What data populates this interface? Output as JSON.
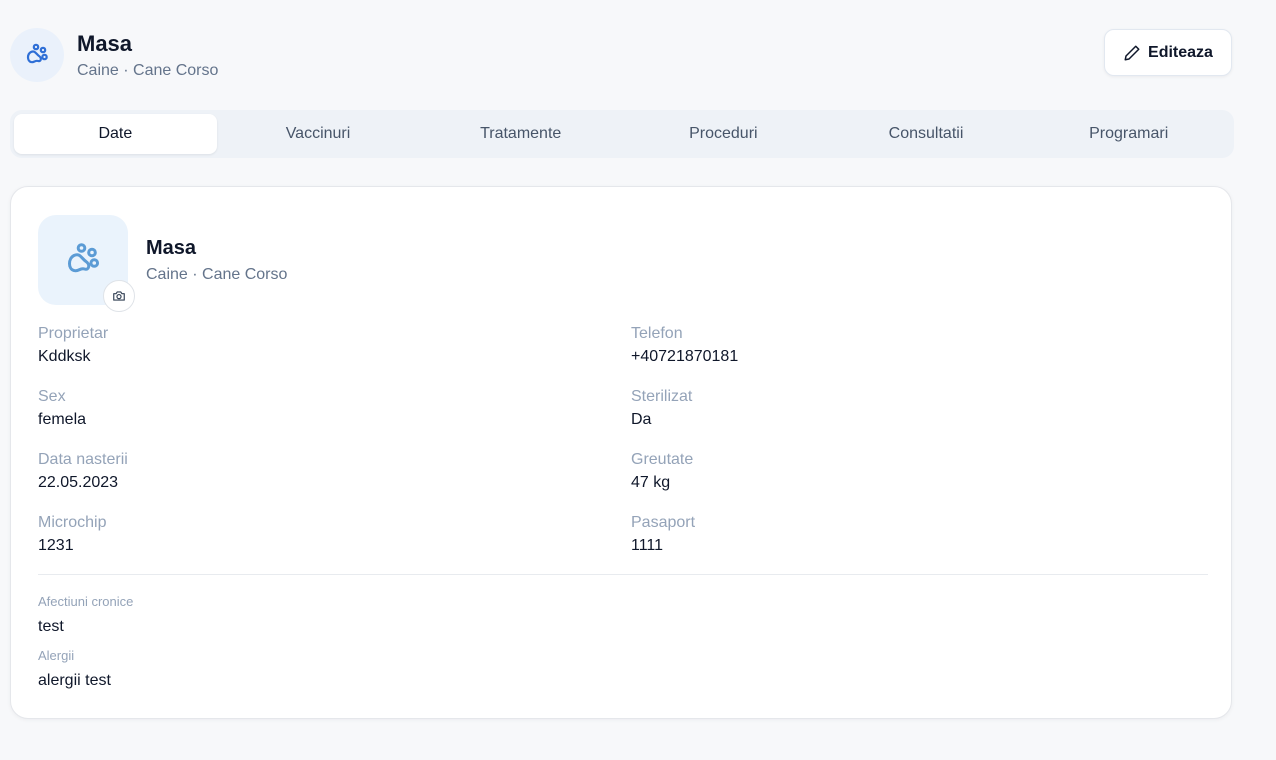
{
  "header": {
    "name": "Masa",
    "subtitle": "Caine · Cane Corso",
    "avatar_icon": "paw-icon",
    "edit_label": "Editeaza",
    "edit_icon": "pencil-icon"
  },
  "tabs": [
    {
      "label": "Date",
      "active": true
    },
    {
      "label": "Vaccinuri",
      "active": false
    },
    {
      "label": "Tratamente",
      "active": false
    },
    {
      "label": "Proceduri",
      "active": false
    },
    {
      "label": "Consultatii",
      "active": false
    },
    {
      "label": "Programari",
      "active": false
    }
  ],
  "card": {
    "name": "Masa",
    "subtitle": "Caine · Cane Corso",
    "photo_icon": "paw-icon",
    "camera_icon": "camera-icon",
    "fields": {
      "owner": {
        "label": "Proprietar",
        "value": "Kddksk"
      },
      "phone": {
        "label": "Telefon",
        "value": "+40721870181"
      },
      "sex": {
        "label": "Sex",
        "value": "femela"
      },
      "neutered": {
        "label": "Sterilizat",
        "value": "Da"
      },
      "birth_date": {
        "label": "Data nasterii",
        "value": "22.05.2023"
      },
      "weight": {
        "label": "Greutate",
        "value": "47 kg"
      },
      "microchip": {
        "label": "Microchip",
        "value": "1231"
      },
      "passport": {
        "label": "Pasaport",
        "value": "1111"
      }
    },
    "chronic": {
      "label": "Afectiuni cronice",
      "value": "test"
    },
    "allergies": {
      "label": "Alergii",
      "value": "alergii test"
    }
  },
  "colors": {
    "accent": "#2f6fd6",
    "paw_light": "#5b9bd5",
    "background": "#f7f8fa"
  }
}
